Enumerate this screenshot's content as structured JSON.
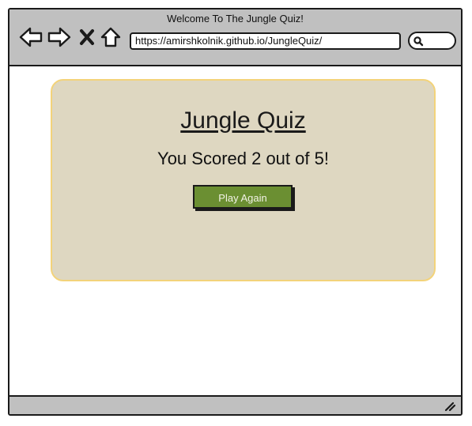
{
  "window": {
    "title": "Welcome To The Jungle Quiz!",
    "url": "https://amirshkolnik.github.io/JungleQuiz/"
  },
  "toolbar": {
    "icons": [
      "back-arrow-icon",
      "forward-arrow-icon",
      "close-icon",
      "home-icon",
      "search-icon"
    ]
  },
  "main": {
    "title": "Jungle Quiz",
    "score_text": "You Scored 2 out of 5!",
    "play_again_label": "Play Again"
  },
  "colors": {
    "chrome": "#c0c0c0",
    "card_bg": "#ded7c1",
    "card_border": "#f3d37a",
    "button_bg": "#6b8f32"
  }
}
